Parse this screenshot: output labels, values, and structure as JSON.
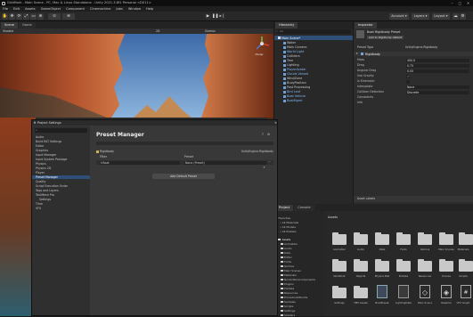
{
  "colors": {
    "accent": "#2e6bbf",
    "selection": "#2e4f78",
    "hierarchy_blue": "#7fb6f2",
    "scene_sky": "#5f8ac0",
    "canyon": "#b4542e"
  },
  "titlebar": {
    "title": "GridMark - Main Scene - PC, Mac & Linux Standalone - Unity 2021.3.8f1 Personal <DX11>",
    "controls": [
      "–",
      "□",
      "✕"
    ]
  },
  "menubar": {
    "items": [
      "File",
      "Edit",
      "Assets",
      "GameObject",
      "Component",
      "Cinemachine",
      "Jobs",
      "Window",
      "Help"
    ]
  },
  "toolbar": {
    "account_label": "Account",
    "layers_label": "Layers",
    "layout_label": "Layout"
  },
  "scene": {
    "tabs": [
      "Scene",
      "Game"
    ],
    "shading": "Shaded",
    "persp": "‹Persp",
    "mode_2d": "2D",
    "gizmos": "Gizmos"
  },
  "hierarchy": {
    "tab": "Hierarchy",
    "search_placeholder": "All",
    "items": [
      {
        "label": "Main Scene*",
        "style": "normal"
      },
      {
        "label": "Water",
        "style": "normal"
      },
      {
        "label": "Main Camera",
        "style": "normal"
      },
      {
        "label": "World Light",
        "style": "blue"
      },
      {
        "label": "Colliders",
        "style": "normal"
      },
      {
        "label": "Tree",
        "style": "normal"
      },
      {
        "label": "Lighting",
        "style": "normal"
      },
      {
        "label": "PlayerAvatar",
        "style": "blue"
      },
      {
        "label": "Clouds Valued",
        "style": "blue"
      },
      {
        "label": "WindZone",
        "style": "normal"
      },
      {
        "label": "BuoyPosition",
        "style": "normal"
      },
      {
        "label": "Post Processing",
        "style": "normal"
      },
      {
        "label": "Bird Leaf",
        "style": "blue"
      },
      {
        "label": "Boat Vehicle",
        "style": "blue"
      },
      {
        "label": "BoatMgmt",
        "style": "blue"
      }
    ]
  },
  "inspector": {
    "tab": "Inspector",
    "object_name": "Boat Rigidbody Preset",
    "set_default_label": "Add to Rigidbody default",
    "preset_type_label": "Preset Type",
    "preset_type_value": "UnityEngine.Rigidbody",
    "component": "Rigidbody",
    "props": [
      {
        "label": "Mass",
        "value": "400.0"
      },
      {
        "label": "Drag",
        "value": "0.75"
      },
      {
        "label": "Angular Drag",
        "value": "0.05"
      },
      {
        "label": "Use Gravity",
        "value": "✓"
      },
      {
        "label": "Is Kinematic",
        "value": ""
      },
      {
        "label": "Interpolate",
        "value": "None"
      },
      {
        "label": "Collision Detection",
        "value": "Discrete"
      },
      {
        "label": "Constraints",
        "value": ""
      },
      {
        "label": "Info",
        "value": ""
      }
    ],
    "footer": "Asset Labels"
  },
  "project": {
    "tab": "Project",
    "console_tab": "Console",
    "assets_header": "Assets",
    "favorites": [
      "Favorites",
      "All Materials",
      "All Models",
      "All Prefabs"
    ],
    "tree": [
      "Assets",
      "Animation",
      "Audio",
      "Data",
      "Editor",
      "Fonts",
      "Gizmos",
      "Main Scenes",
      "Materials",
      "NordicSkinComponents",
      "Plugins",
      "Prefabs",
      "Resources",
      "ProceduralWorlds",
      "Samples",
      "Scripts",
      "Settings",
      "Shaders"
    ],
    "grid": [
      {
        "label": "Animation",
        "kind": "folder"
      },
      {
        "label": "Audio",
        "kind": "folder"
      },
      {
        "label": "Data",
        "kind": "folder"
      },
      {
        "label": "Fonts",
        "kind": "folder"
      },
      {
        "label": "Gizmos",
        "kind": "folder"
      },
      {
        "label": "Main Scenes",
        "kind": "folder"
      },
      {
        "label": "Materials",
        "kind": "folder"
      },
      {
        "label": "NordRoot",
        "kind": "folder"
      },
      {
        "label": "Objects",
        "kind": "folder"
      },
      {
        "label": "Physics Mat",
        "kind": "folder"
      },
      {
        "label": "Prefabs",
        "kind": "folder"
      },
      {
        "label": "Resources",
        "kind": "folder"
      },
      {
        "label": "Scenes",
        "kind": "folder"
      },
      {
        "label": "Scripts",
        "kind": "folder"
      },
      {
        "label": "Settings",
        "kind": "folder"
      },
      {
        "label": "TMP Assets",
        "kind": "folder"
      },
      {
        "label": "BoatPreset",
        "kind": "preset"
      },
      {
        "label": "LightingData",
        "kind": "data"
      },
      {
        "label": "Main Scene",
        "kind": "unity"
      },
      {
        "label": "Readme",
        "kind": "unity"
      },
      {
        "label": "VFX Graph",
        "kind": "script"
      }
    ]
  },
  "project_settings": {
    "title": "Project Settings",
    "search_placeholder": "",
    "items": [
      "Audio",
      "Build MLT Settings",
      "Editor",
      "Graphics",
      "Input Manager",
      "Input System Package",
      "Physics",
      "Physics 2D",
      "Player",
      "Preset Manager",
      "Quality",
      "Script Execution Order",
      "Tags and Layers",
      "TextMesh Pro",
      "Settings",
      "Time",
      "VFX"
    ],
    "selected_index": 9,
    "panel": {
      "title": "Preset Manager",
      "type_label": "Rigidbody",
      "type_value": "UnityEngine.Rigidbody",
      "col_filter": "Filter",
      "col_preset": "Preset",
      "row_filter": "t:Boat",
      "row_preset": "None (Preset)",
      "add_button": "Add Default Preset"
    }
  }
}
